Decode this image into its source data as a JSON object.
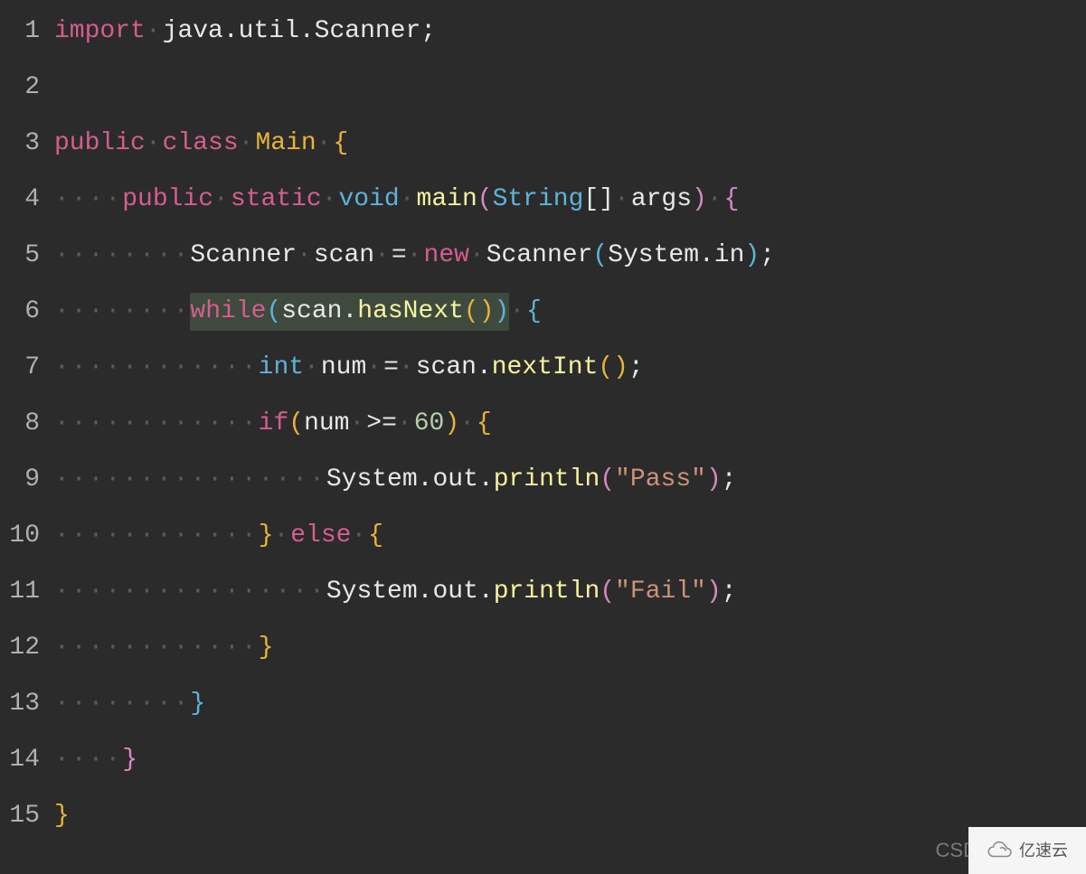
{
  "lineNumbers": [
    "1",
    "2",
    "3",
    "4",
    "5",
    "6",
    "7",
    "8",
    "9",
    "10",
    "11",
    "12",
    "13",
    "14",
    "15"
  ],
  "code": {
    "line1": {
      "import": "import",
      "sp": "·",
      "pkg": "java.util.Scanner;"
    },
    "line3": {
      "public": "public",
      "sp1": "·",
      "class": "class",
      "sp2": "·",
      "name": "Main",
      "sp3": "·",
      "brace": "{"
    },
    "line4": {
      "indent": "····",
      "public": "public",
      "sp1": "·",
      "static": "static",
      "sp2": "·",
      "void": "void",
      "sp3": "·",
      "main": "main",
      "paren1": "(",
      "string": "String",
      "brackets": "[]",
      "sp4": "·",
      "args": "args",
      "paren2": ")",
      "sp5": "·",
      "brace": "{"
    },
    "line5": {
      "indent": "········",
      "scanner1": "Scanner",
      "sp1": "·",
      "scan": "scan",
      "sp2": "·",
      "eq": "=",
      "sp3": "·",
      "new": "new",
      "sp4": "·",
      "scanner2": "Scanner",
      "paren1": "(",
      "system": "System.in",
      "paren2": ")",
      "semi": ";"
    },
    "line6": {
      "indent": "········",
      "while": "while",
      "paren1": "(",
      "scan": "scan.",
      "hasNext": "hasNext",
      "parens": "()",
      "paren2": ")",
      "sp": "·",
      "brace": "{"
    },
    "line7": {
      "indent": "············",
      "int": "int",
      "sp1": "·",
      "num": "num",
      "sp2": "·",
      "eq": "=",
      "sp3": "·",
      "scan": "scan.",
      "nextInt": "nextInt",
      "parens": "()",
      "semi": ";"
    },
    "line8": {
      "indent": "············",
      "if": "if",
      "paren1": "(",
      "num": "num",
      "sp1": "·",
      "gte": ">=",
      "sp2": "·",
      "sixty": "60",
      "paren2": ")",
      "sp3": "·",
      "brace": "{"
    },
    "line9": {
      "indent": "················",
      "sysout": "System.out.",
      "println": "println",
      "paren1": "(",
      "str": "\"Pass\"",
      "paren2": ")",
      "semi": ";"
    },
    "line10": {
      "indent": "············",
      "brace1": "}",
      "sp1": "·",
      "else": "else",
      "sp2": "·",
      "brace2": "{"
    },
    "line11": {
      "indent": "················",
      "sysout": "System.out.",
      "println": "println",
      "paren1": "(",
      "str": "\"Fail\"",
      "paren2": ")",
      "semi": ";"
    },
    "line12": {
      "indent": "············",
      "brace": "}"
    },
    "line13": {
      "indent": "········",
      "brace": "}"
    },
    "line14": {
      "indent": "····",
      "brace": "}"
    },
    "line15": {
      "brace": "}"
    }
  },
  "watermark": {
    "csd": "CSD",
    "badgeText": "亿速云"
  }
}
